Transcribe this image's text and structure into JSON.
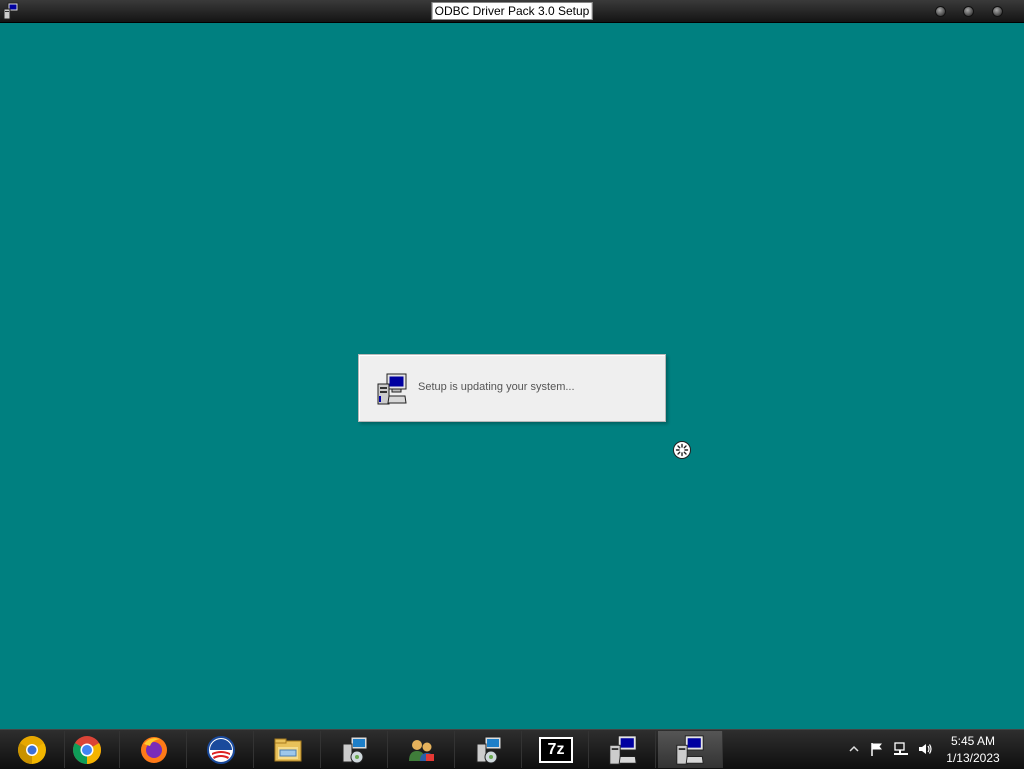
{
  "window": {
    "title": "ODBC Driver Pack 3.0 Setup",
    "app_icon": "setup-computer-icon"
  },
  "dialog": {
    "message": "Setup is updating your system...",
    "icon": "setup-computer-icon"
  },
  "cursor": {
    "icon": "busy-cursor-icon"
  },
  "taskbar": {
    "items": [
      {
        "icon": "chrome-canary-icon"
      },
      {
        "icon": "chrome-icon"
      },
      {
        "icon": "firefox-icon"
      },
      {
        "icon": "obama-logo-icon"
      },
      {
        "icon": "file-explorer-icon"
      },
      {
        "icon": "setup-installer-icon"
      },
      {
        "icon": "network-users-icon"
      },
      {
        "icon": "setup-installer-icon"
      },
      {
        "icon": "7zip-icon",
        "label": "7z"
      },
      {
        "icon": "setup-computer-icon"
      },
      {
        "icon": "setup-computer-icon",
        "active": true
      }
    ],
    "tray": [
      "show-hidden-icons-icon",
      "flag-icon",
      "network-icon",
      "volume-icon"
    ],
    "clock": {
      "time": "5:45 AM",
      "date": "1/13/2023"
    }
  },
  "colors": {
    "desktop": "#008080",
    "taskbar": "#1c1c1c",
    "dialog_bg": "#efefef"
  }
}
